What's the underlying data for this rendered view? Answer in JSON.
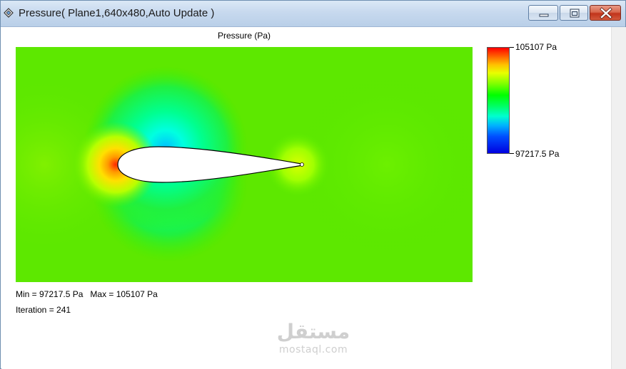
{
  "window": {
    "title": "Pressure( Plane1,640x480,Auto Update )",
    "icon": "plot-window-icon",
    "controls": [
      "minimize-icon",
      "maximize-icon",
      "close-icon"
    ]
  },
  "plot": {
    "title": "Pressure (Pa)",
    "colormap": [
      "#ff0000",
      "#ffc000",
      "#80ff00",
      "#00ff00",
      "#00ffd0",
      "#00b0ff",
      "#0000e0"
    ]
  },
  "legend": {
    "max_label": "105107 Pa",
    "min_label": "97217.5 Pa"
  },
  "stats": {
    "min_text": "Min = 97217.5 Pa",
    "max_text": "Max = 105107 Pa",
    "iteration_text": "Iteration = 241"
  },
  "watermark": {
    "arabic": "مستقل",
    "latin": "mostaql.com"
  }
}
